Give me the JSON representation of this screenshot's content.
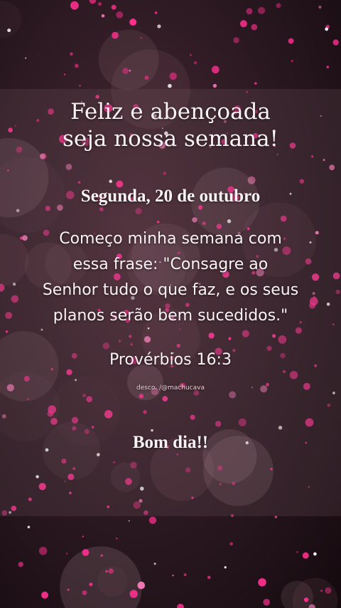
{
  "card": {
    "title_line1": "Feliz e abençoada",
    "title_line2": "seja nossa semana!",
    "date": "Segunda, 20 de outubro",
    "quote_line1": "Começo minha semana com",
    "quote_line2": "essa frase: \"Consagre ao",
    "quote_line3": "Senhor tudo o que faz, e os seus",
    "quote_line4": "planos serão bem sucedidos.\"",
    "reference": "Provérbios 16:3",
    "credit": "desco. /@machucava",
    "greeting": "Bom dia!!"
  },
  "colors": {
    "background": "#2a1820",
    "sparkle_pink": "#ff2f8f",
    "text": "#fbf3f5"
  }
}
